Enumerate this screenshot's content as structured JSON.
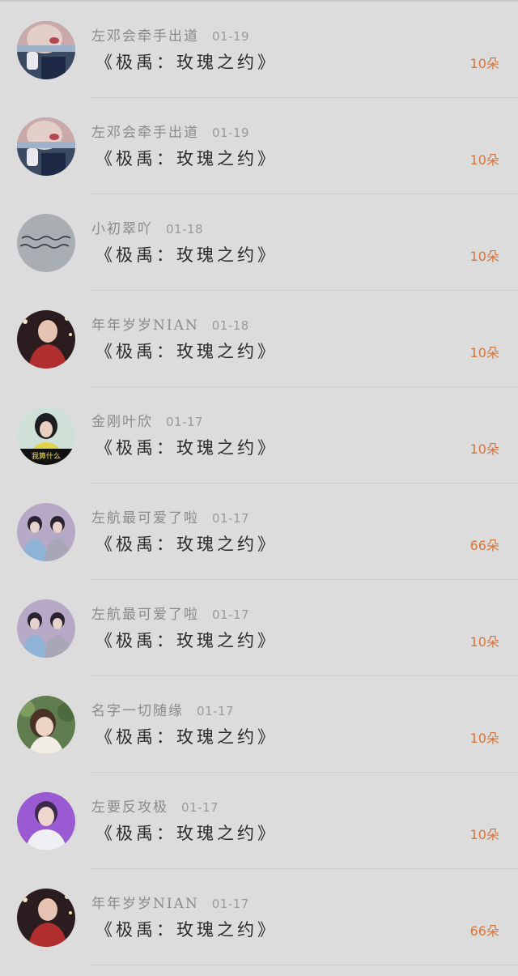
{
  "rows": [
    {
      "user": "左邓会牵手出道",
      "date": "01-19",
      "title": "《极禹：玫瑰之约》",
      "amount": "10朵",
      "avatar": "avatar-a"
    },
    {
      "user": "左邓会牵手出道",
      "date": "01-19",
      "title": "《极禹：玫瑰之约》",
      "amount": "10朵",
      "avatar": "avatar-a"
    },
    {
      "user": "小初翠吖",
      "date": "01-18",
      "title": "《极禹：玫瑰之约》",
      "amount": "10朵",
      "avatar": "avatar-handwriting"
    },
    {
      "user": "年年岁岁NIAN",
      "date": "01-18",
      "title": "《极禹：玫瑰之约》",
      "amount": "10朵",
      "avatar": "avatar-red"
    },
    {
      "user": "金刚叶欣",
      "date": "01-17",
      "title": "《极禹：玫瑰之约》",
      "amount": "10朵",
      "avatar": "avatar-yellow",
      "avatar_caption": "我算什么"
    },
    {
      "user": "左航最可爱了啦",
      "date": "01-17",
      "title": "《极禹：玫瑰之约》",
      "amount": "66朵",
      "avatar": "avatar-duo"
    },
    {
      "user": "左航最可爱了啦",
      "date": "01-17",
      "title": "《极禹：玫瑰之约》",
      "amount": "10朵",
      "avatar": "avatar-duo"
    },
    {
      "user": "名字一切随缘",
      "date": "01-17",
      "title": "《极禹：玫瑰之约》",
      "amount": "10朵",
      "avatar": "avatar-green"
    },
    {
      "user": "左要反攻极",
      "date": "01-17",
      "title": "《极禹：玫瑰之约》",
      "amount": "10朵",
      "avatar": "avatar-purple"
    },
    {
      "user": "年年岁岁NIAN",
      "date": "01-17",
      "title": "《极禹：玫瑰之约》",
      "amount": "66朵",
      "avatar": "avatar-red"
    }
  ],
  "colors": {
    "background": "#dcdcdc",
    "amount": "#d5753b",
    "meta": "#8a8a8a",
    "title": "#2b2b2b"
  }
}
